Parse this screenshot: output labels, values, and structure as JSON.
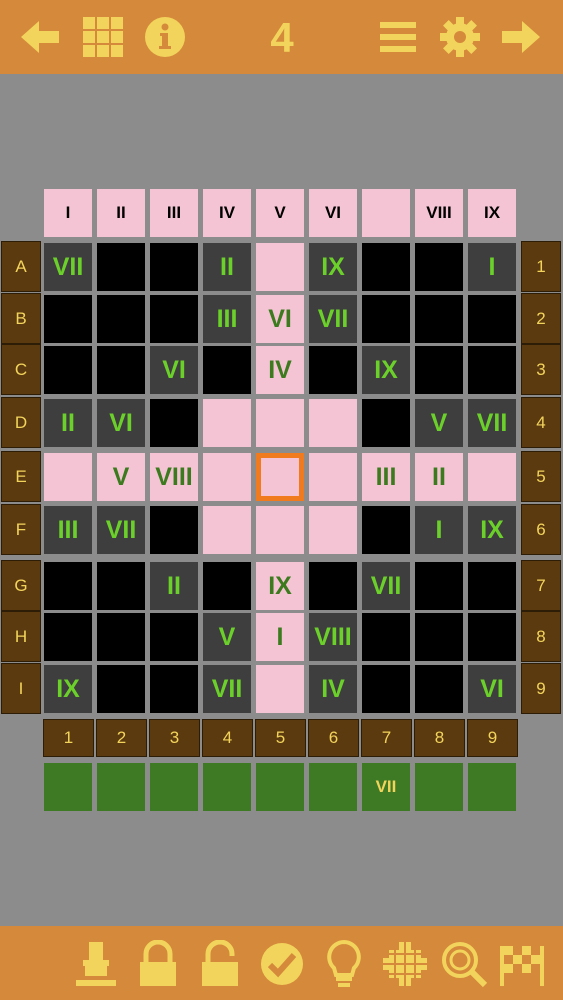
{
  "header": {
    "puzzle_number": "4",
    "icons": [
      "back-arrow-icon",
      "grid-icon",
      "info-icon",
      "menu-icon",
      "settings-gear-icon",
      "forward-arrow-icon"
    ]
  },
  "footer": {
    "icons": [
      "stamp-icon",
      "lock-icon",
      "unlock-icon",
      "check-icon",
      "hint-bulb-icon",
      "crosshair-icon",
      "magnify-icon",
      "finish-flag-icon"
    ]
  },
  "colors": {
    "bar": "#d5893a",
    "icon": "#f2d45c",
    "pink": "#f4c4d4",
    "black": "#000000",
    "dark": "#3e3e3e",
    "green_text": "#6bd12a",
    "selected": "#f07a1e",
    "answer": "#3e7a24",
    "label_bg": "#5c3a0f"
  },
  "board": {
    "column_headers": [
      "I",
      "II",
      "III",
      "IV",
      "V",
      "VI",
      "",
      "VIII",
      "IX"
    ],
    "row_labels": [
      "A",
      "B",
      "C",
      "D",
      "E",
      "F",
      "G",
      "H",
      "I"
    ],
    "row_numbers": [
      "1",
      "2",
      "3",
      "4",
      "5",
      "6",
      "7",
      "8",
      "9"
    ],
    "column_numbers": [
      "1",
      "2",
      "3",
      "4",
      "5",
      "6",
      "7",
      "8",
      "9"
    ],
    "cells": [
      [
        {
          "t": "dark",
          "v": "VII"
        },
        {
          "t": "black",
          "v": ""
        },
        {
          "t": "black",
          "v": ""
        },
        {
          "t": "dark",
          "v": "II"
        },
        {
          "t": "pink",
          "v": ""
        },
        {
          "t": "dark",
          "v": "IX"
        },
        {
          "t": "black",
          "v": ""
        },
        {
          "t": "black",
          "v": ""
        },
        {
          "t": "dark",
          "v": "I"
        }
      ],
      [
        {
          "t": "black",
          "v": ""
        },
        {
          "t": "black",
          "v": ""
        },
        {
          "t": "black",
          "v": ""
        },
        {
          "t": "dark",
          "v": "III"
        },
        {
          "t": "pink",
          "v": "VI"
        },
        {
          "t": "dark",
          "v": "VII"
        },
        {
          "t": "black",
          "v": ""
        },
        {
          "t": "black",
          "v": ""
        },
        {
          "t": "black",
          "v": ""
        }
      ],
      [
        {
          "t": "black",
          "v": ""
        },
        {
          "t": "black",
          "v": ""
        },
        {
          "t": "dark",
          "v": "VI"
        },
        {
          "t": "black",
          "v": ""
        },
        {
          "t": "pink",
          "v": "IV"
        },
        {
          "t": "black",
          "v": ""
        },
        {
          "t": "dark",
          "v": "IX"
        },
        {
          "t": "black",
          "v": ""
        },
        {
          "t": "black",
          "v": ""
        }
      ],
      [
        {
          "t": "dark",
          "v": "II"
        },
        {
          "t": "dark",
          "v": "VI"
        },
        {
          "t": "black",
          "v": ""
        },
        {
          "t": "pink",
          "v": ""
        },
        {
          "t": "pink",
          "v": ""
        },
        {
          "t": "pink",
          "v": ""
        },
        {
          "t": "black",
          "v": ""
        },
        {
          "t": "dark",
          "v": "V"
        },
        {
          "t": "dark",
          "v": "VII"
        }
      ],
      [
        {
          "t": "pink",
          "v": ""
        },
        {
          "t": "pink",
          "v": "V"
        },
        {
          "t": "pink",
          "v": "VIII"
        },
        {
          "t": "pink",
          "v": ""
        },
        {
          "t": "selected",
          "v": ""
        },
        {
          "t": "pink",
          "v": ""
        },
        {
          "t": "pink",
          "v": "III"
        },
        {
          "t": "pink",
          "v": "II"
        },
        {
          "t": "pink",
          "v": ""
        }
      ],
      [
        {
          "t": "dark",
          "v": "III"
        },
        {
          "t": "dark",
          "v": "VII"
        },
        {
          "t": "black",
          "v": ""
        },
        {
          "t": "pink",
          "v": ""
        },
        {
          "t": "pink",
          "v": ""
        },
        {
          "t": "pink",
          "v": ""
        },
        {
          "t": "black",
          "v": ""
        },
        {
          "t": "dark",
          "v": "I"
        },
        {
          "t": "dark",
          "v": "IX"
        }
      ],
      [
        {
          "t": "black",
          "v": ""
        },
        {
          "t": "black",
          "v": ""
        },
        {
          "t": "dark",
          "v": "II"
        },
        {
          "t": "black",
          "v": ""
        },
        {
          "t": "pink",
          "v": "IX"
        },
        {
          "t": "black",
          "v": ""
        },
        {
          "t": "dark",
          "v": "VII"
        },
        {
          "t": "black",
          "v": ""
        },
        {
          "t": "black",
          "v": ""
        }
      ],
      [
        {
          "t": "black",
          "v": ""
        },
        {
          "t": "black",
          "v": ""
        },
        {
          "t": "black",
          "v": ""
        },
        {
          "t": "dark",
          "v": "V"
        },
        {
          "t": "pink",
          "v": "I"
        },
        {
          "t": "dark",
          "v": "VIII"
        },
        {
          "t": "black",
          "v": ""
        },
        {
          "t": "black",
          "v": ""
        },
        {
          "t": "black",
          "v": ""
        }
      ],
      [
        {
          "t": "dark",
          "v": "IX"
        },
        {
          "t": "black",
          "v": ""
        },
        {
          "t": "black",
          "v": ""
        },
        {
          "t": "dark",
          "v": "VII"
        },
        {
          "t": "pink",
          "v": ""
        },
        {
          "t": "dark",
          "v": "IV"
        },
        {
          "t": "black",
          "v": ""
        },
        {
          "t": "black",
          "v": ""
        },
        {
          "t": "dark",
          "v": "VI"
        }
      ]
    ],
    "answer_row": [
      "",
      "",
      "",
      "",
      "",
      "",
      "VII",
      "",
      ""
    ]
  }
}
